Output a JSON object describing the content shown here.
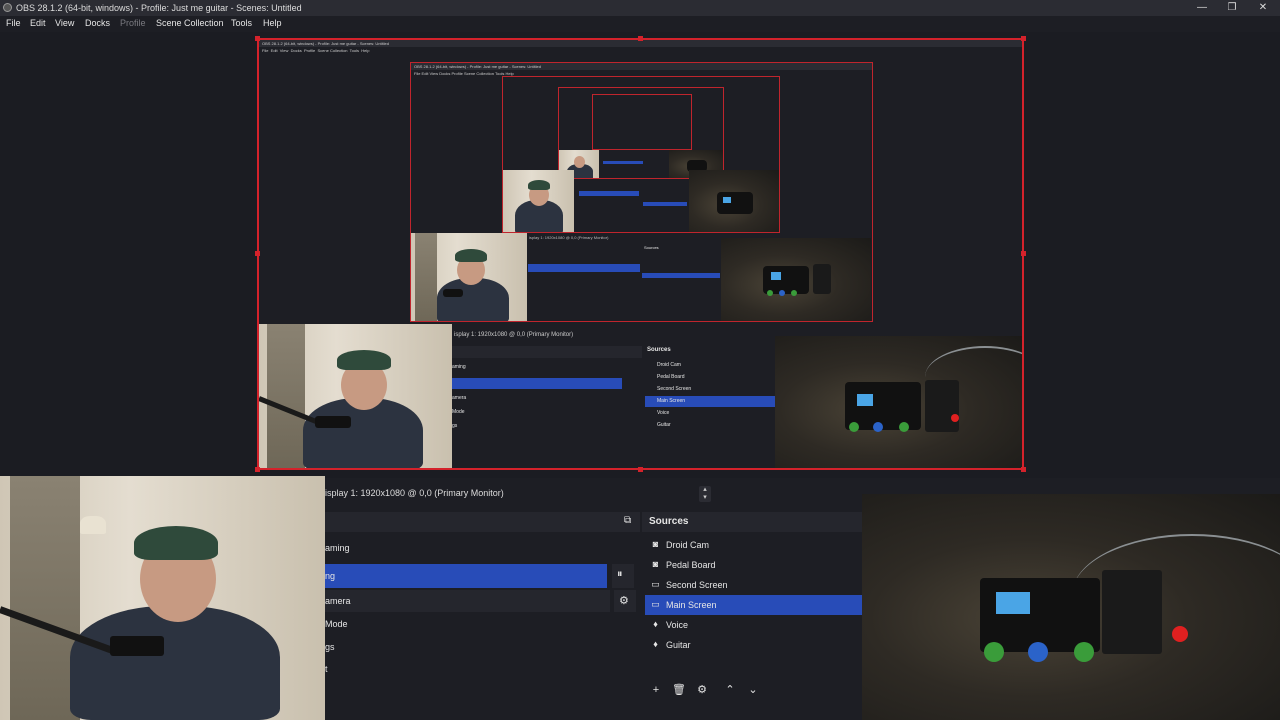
{
  "window": {
    "title": "OBS 28.1.2 (64-bit, windows) - Profile: Just me guitar - Scenes: Untitled",
    "minimize": "—",
    "maximize": "❐",
    "close": "✕"
  },
  "menu": [
    "File",
    "Edit",
    "View",
    "Docks",
    "Profile",
    "Scene Collection",
    "Tools",
    "Help"
  ],
  "preview": {
    "display_label": "isplay 1: 1920x1080 @ 0,0 (Primary Monitor)",
    "display_label_small": "isplay 1: 1920x1080 @ 0,0 (Primary Monitor)"
  },
  "scenes": {
    "rows": [
      "aming",
      "ng",
      "amera",
      "Mode",
      "gs",
      "t"
    ],
    "selected_index": 1
  },
  "sources": {
    "title": "Sources",
    "items": [
      {
        "label": "Droid Cam",
        "icon": "camera-icon"
      },
      {
        "label": "Pedal Board",
        "icon": "camera-icon"
      },
      {
        "label": "Second Screen",
        "icon": "monitor-icon"
      },
      {
        "label": "Main Screen",
        "icon": "monitor-icon"
      },
      {
        "label": "Voice",
        "icon": "microphone-icon"
      },
      {
        "label": "Guitar",
        "icon": "microphone-icon"
      }
    ],
    "selected_index": 3,
    "toolbar": [
      "add-icon",
      "trash-icon",
      "gear-icon",
      "chevron-up-icon",
      "chevron-down-icon"
    ]
  },
  "colors": {
    "selection": "#284cb8",
    "preview_border": "#d4222b",
    "panel_bg": "#1d1e24"
  }
}
